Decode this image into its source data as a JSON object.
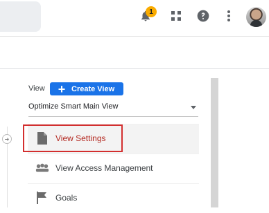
{
  "topbar": {
    "notification_count": "1"
  },
  "icons": {
    "bell": "notifications-icon",
    "apps": "apps-grid-icon",
    "help": "help-icon",
    "more": "more-vert-icon",
    "profile": "avatar"
  },
  "view_header": {
    "label": "View",
    "create_button": "Create View",
    "selected_view": "Optimize Smart Main View"
  },
  "nav_items": [
    {
      "label": "View Settings",
      "icon": "document-icon",
      "highlighted": true
    },
    {
      "label": "View Access Management",
      "icon": "people-icon",
      "highlighted": false
    },
    {
      "label": "Goals",
      "icon": "flag-icon",
      "highlighted": false
    }
  ],
  "colors": {
    "accent": "#1a73e8",
    "badge": "#f9ab00",
    "highlight": "#d32f2f"
  }
}
